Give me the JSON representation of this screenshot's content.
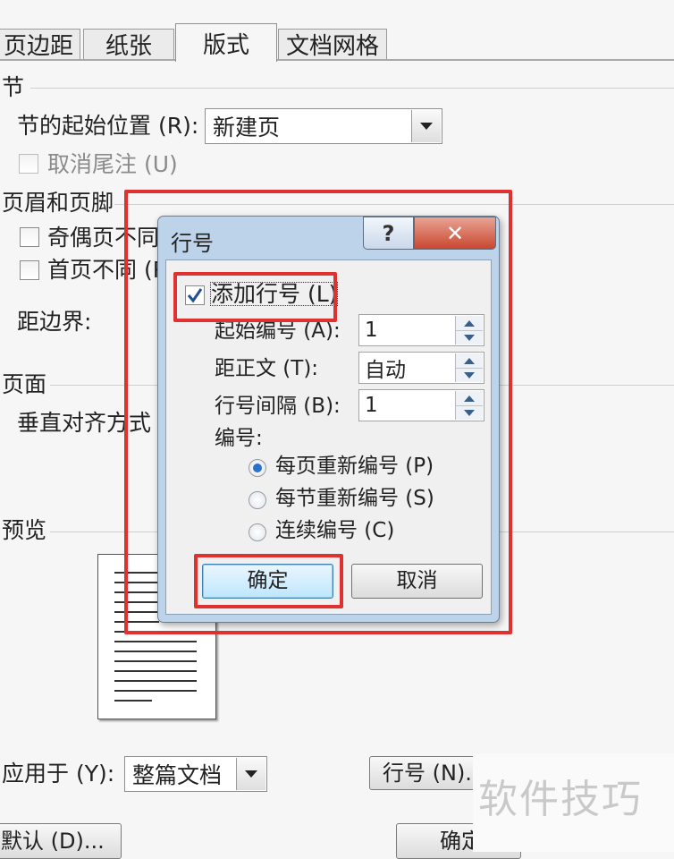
{
  "tabs": [
    {
      "label": "页边距"
    },
    {
      "label": "纸张"
    },
    {
      "label": "版式"
    },
    {
      "label": "文档网格"
    }
  ],
  "section": {
    "header": "节",
    "start_label": "节的起始位置 (R):",
    "start_value": "新建页",
    "suppress_endnotes": "取消尾注 (U)"
  },
  "headers_footers": {
    "header": "页眉和页脚",
    "odd_even": "奇偶页不同",
    "first_page": "首页不同 (P",
    "from_edge": "距边界:"
  },
  "page": {
    "header": "页面",
    "vertical_align": "垂直对齐方式 ("
  },
  "preview": {
    "header": "预览",
    "apply_to_label": "应用于 (Y):",
    "apply_to_value": "整篇文档",
    "line_numbers_button": "行号 (N)..."
  },
  "footer": {
    "default_button": "默认 (D)...",
    "ok_button": "确定"
  },
  "dialog": {
    "title": "行号",
    "help": "?",
    "close": "✕",
    "add_line_numbers": "添加行号 (L)",
    "start_at_label": "起始编号 (A):",
    "start_at_value": "1",
    "from_text_label": "距正文 (T):",
    "from_text_value": "自动",
    "count_by_label": "行号间隔 (B):",
    "count_by_value": "1",
    "numbering_label": "编号:",
    "options": [
      {
        "label": "每页重新编号 (P)",
        "selected": true
      },
      {
        "label": "每节重新编号 (S)",
        "selected": false
      },
      {
        "label": "连续编号 (C)",
        "selected": false
      }
    ],
    "ok": "确定",
    "cancel": "取消"
  },
  "watermark": "软件技巧",
  "colors": {
    "highlight": "#e03131",
    "radio_selected": "#2a6fc9",
    "checkmark": "#1f4f9a"
  }
}
